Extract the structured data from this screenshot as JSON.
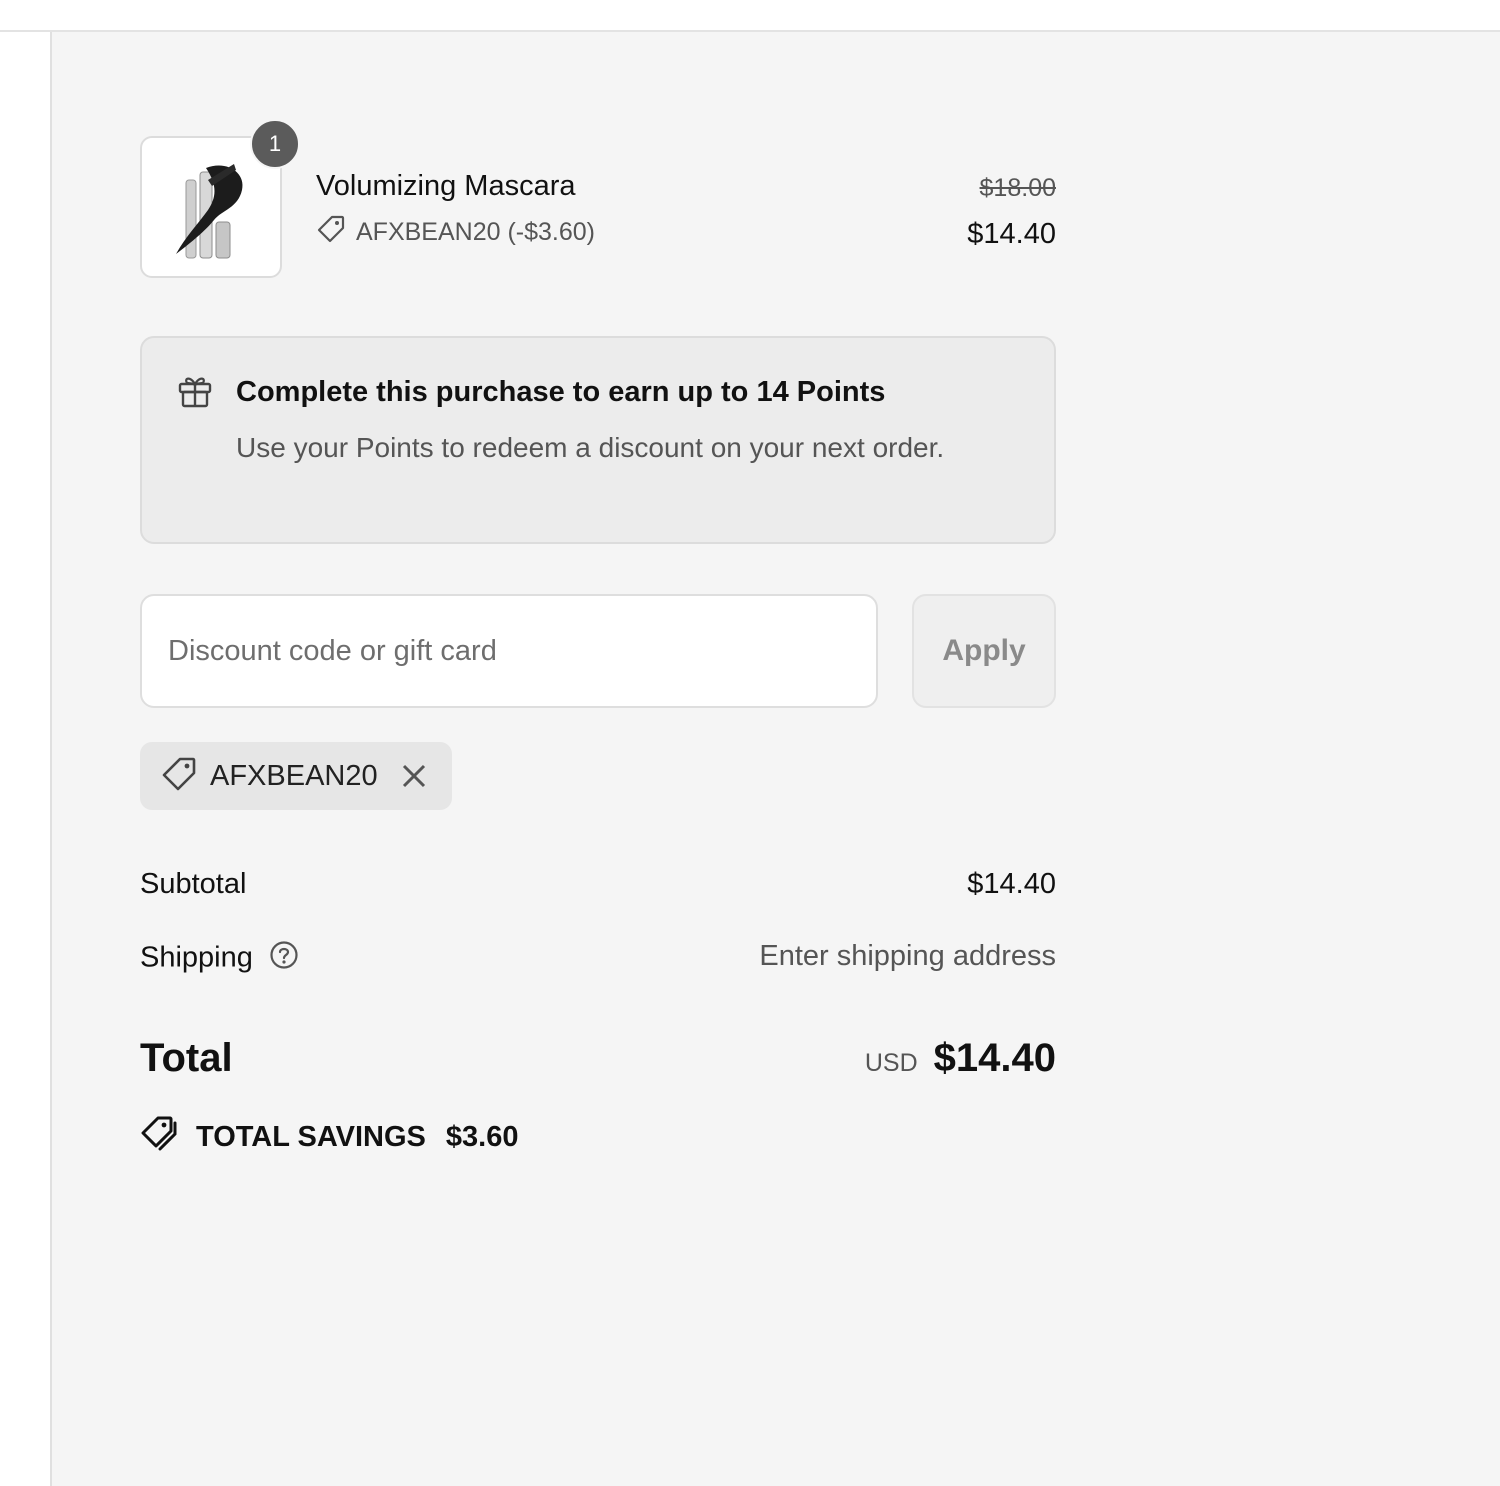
{
  "line_item": {
    "quantity": "1",
    "name": "Volumizing Mascara",
    "discount_label": "AFXBEAN20 (-$3.60)",
    "original_price": "$18.00",
    "price": "$14.40"
  },
  "points_banner": {
    "title": "Complete this purchase to earn up to 14 Points",
    "subtitle": "Use your Points to redeem a discount on your next order."
  },
  "discount": {
    "placeholder": "Discount code or gift card",
    "value": "",
    "apply_label": "Apply",
    "applied_code": "AFXBEAN20"
  },
  "summary": {
    "subtotal_label": "Subtotal",
    "subtotal_value": "$14.40",
    "shipping_label": "Shipping",
    "shipping_value": "Enter shipping address",
    "total_label": "Total",
    "currency": "USD",
    "total_value": "$14.40",
    "savings_label": "TOTAL SAVINGS",
    "savings_value": "$3.60"
  },
  "icons": {
    "tag": "tag-icon",
    "gift": "gift-icon",
    "close": "close-icon",
    "help": "help-circle-icon",
    "savings": "double-tag-icon"
  },
  "colors": {
    "panel_bg": "#f5f5f5",
    "badge_bg": "#5b5b5b",
    "muted_text": "#555555"
  }
}
